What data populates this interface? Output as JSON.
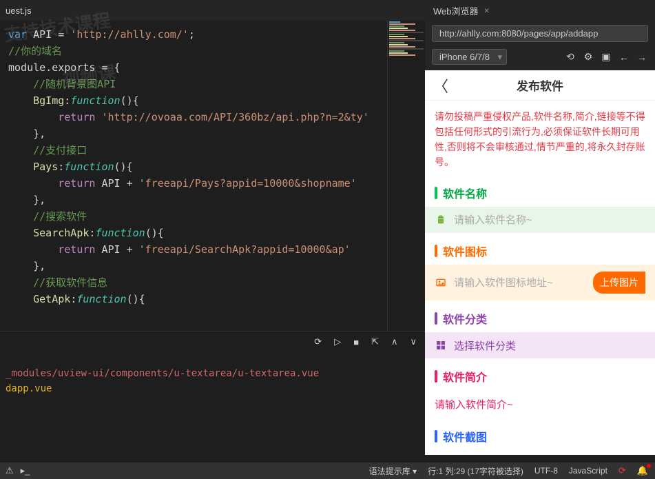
{
  "editor": {
    "tab": "uest.js",
    "code_lines": [
      {
        "segs": [
          [
            "kw",
            "var"
          ],
          [
            "",
            " API = "
          ],
          [
            "str",
            "'http://ahlly.com/'"
          ],
          [
            "",
            ";"
          ]
        ]
      },
      {
        "segs": [
          [
            "cmt",
            "//你的域名"
          ]
        ]
      },
      {
        "segs": [
          [
            "",
            "module.exports = {"
          ]
        ]
      },
      {
        "segs": [
          [
            "",
            "    "
          ],
          [
            "cmt",
            "//随机背景图API"
          ]
        ]
      },
      {
        "segs": [
          [
            "",
            "    "
          ],
          [
            "fn",
            "BgImg"
          ],
          [
            "",
            ":"
          ],
          [
            "fnkw",
            "function"
          ],
          [
            "",
            "(){"
          ]
        ]
      },
      {
        "segs": [
          [
            "",
            "        "
          ],
          [
            "ret",
            "return"
          ],
          [
            "",
            " "
          ],
          [
            "str",
            "'http://ovoaa.com/API/360bz/api.php?n=2&ty'"
          ]
        ]
      },
      {
        "segs": [
          [
            "",
            "    },"
          ]
        ]
      },
      {
        "segs": [
          [
            "",
            "    "
          ],
          [
            "cmt",
            "//支付接口"
          ]
        ]
      },
      {
        "segs": [
          [
            "",
            "    "
          ],
          [
            "fn",
            "Pays"
          ],
          [
            "",
            ":"
          ],
          [
            "fnkw",
            "function"
          ],
          [
            "",
            "(){"
          ]
        ]
      },
      {
        "segs": [
          [
            "",
            "        "
          ],
          [
            "ret",
            "return"
          ],
          [
            "",
            " API + "
          ],
          [
            "str",
            "'freeapi/Pays?appid=10000&shopname'"
          ]
        ]
      },
      {
        "segs": [
          [
            "",
            "    },"
          ]
        ]
      },
      {
        "segs": [
          [
            "",
            "    "
          ],
          [
            "cmt",
            "//搜索软件"
          ]
        ]
      },
      {
        "segs": [
          [
            "",
            "    "
          ],
          [
            "fn",
            "SearchApk"
          ],
          [
            "",
            ":"
          ],
          [
            "fnkw",
            "function"
          ],
          [
            "",
            "(){"
          ]
        ]
      },
      {
        "segs": [
          [
            "",
            "        "
          ],
          [
            "ret",
            "return"
          ],
          [
            "",
            " API + "
          ],
          [
            "str",
            "'freeapi/SearchApk?appid=10000&ap'"
          ]
        ]
      },
      {
        "segs": [
          [
            "",
            "    },"
          ]
        ]
      },
      {
        "segs": [
          [
            "",
            "    "
          ],
          [
            "cmt",
            "//获取软件信息"
          ]
        ]
      },
      {
        "segs": [
          [
            "",
            "    "
          ],
          [
            "fn",
            "GetApk"
          ],
          [
            "",
            ":"
          ],
          [
            "fnkw",
            "function"
          ],
          [
            "",
            "(){"
          ]
        ]
      }
    ]
  },
  "terminal": {
    "line1": "_modules/uview-ui/components/u-textarea/u-textarea.vue",
    "line2": "dapp.vue"
  },
  "browser": {
    "tab": "Web浏览器",
    "url": "http://ahlly.com:8080/pages/app/addapp",
    "device": "iPhone 6/7/8"
  },
  "phone": {
    "title": "发布软件",
    "notice": "请勿投稿严重侵权产品,软件名称,简介,链接等不得包括任何形式的引流行为,必须保证软件长期可用性,否则将不会审核通过,情节严重的,将永久封存账号。",
    "sections": {
      "name": {
        "title": "软件名称",
        "placeholder": "请输入软件名称~"
      },
      "icon": {
        "title": "软件图标",
        "placeholder": "请输入软件图标地址~",
        "upload": "上传图片"
      },
      "category": {
        "title": "软件分类",
        "placeholder": "选择软件分类"
      },
      "intro": {
        "title": "软件简介",
        "placeholder": "请输入软件简介~"
      },
      "screenshot": {
        "title": "软件截图"
      }
    }
  },
  "statusbar": {
    "hint": "语法提示库",
    "pos": "行:1  列:29 (17字符被选择)",
    "encoding": "UTF-8",
    "lang": "JavaScript"
  }
}
